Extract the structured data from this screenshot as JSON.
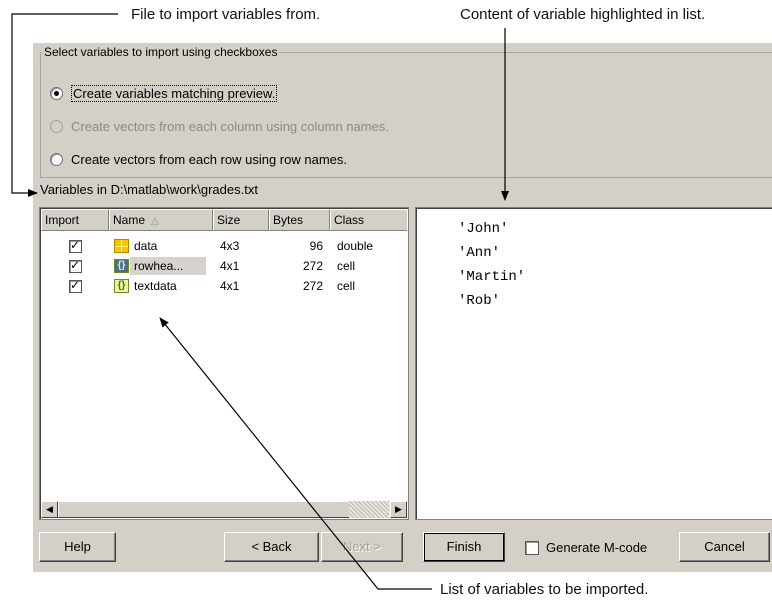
{
  "annotations": {
    "file_source": "File to import variables from.",
    "content_highlighted": "Content of variable highlighted in list.",
    "list_of_variables": "List of variables to be imported."
  },
  "options": {
    "group_label": "Select variables to import using checkboxes",
    "radio_preview": "Create variables matching preview.",
    "radio_columns": "Create vectors from each column using column names.",
    "radio_rows": "Create vectors from each row using row names.",
    "selected": "preview"
  },
  "variables_location": "Variables in D:\\matlab\\work\\grades.txt",
  "table": {
    "headers": {
      "import": "Import",
      "name": "Name",
      "size": "Size",
      "bytes": "Bytes",
      "class": "Class"
    },
    "sort_indicator": "△",
    "rows": [
      {
        "import": true,
        "icon": "matrix-icon",
        "name": "data",
        "size": "4x3",
        "bytes": "96",
        "class": "double"
      },
      {
        "import": true,
        "icon": "cell-array-icon",
        "name": "rowhea...",
        "size": "4x1",
        "bytes": "272",
        "class": "cell",
        "highlighted": true
      },
      {
        "import": true,
        "icon": "cell-array-icon",
        "name": "textdata",
        "size": "4x1",
        "bytes": "272",
        "class": "cell"
      }
    ],
    "cell_icon_glyph": "{}"
  },
  "content_preview": [
    "'John'",
    "'Ann'",
    "'Martin'",
    "'Rob'"
  ],
  "buttons": {
    "help": "Help",
    "back": "< Back",
    "next": "Next >",
    "finish": "Finish",
    "generate_mcode": "Generate M-code",
    "cancel": "Cancel"
  },
  "generate_mcode_checked": false,
  "colors": {
    "dialog_bg": "#d4d0c8",
    "grid_icon": "#f3c700",
    "cell_icon_dark": "#4f6f80",
    "cell_icon_light": "#ecf6a0"
  }
}
